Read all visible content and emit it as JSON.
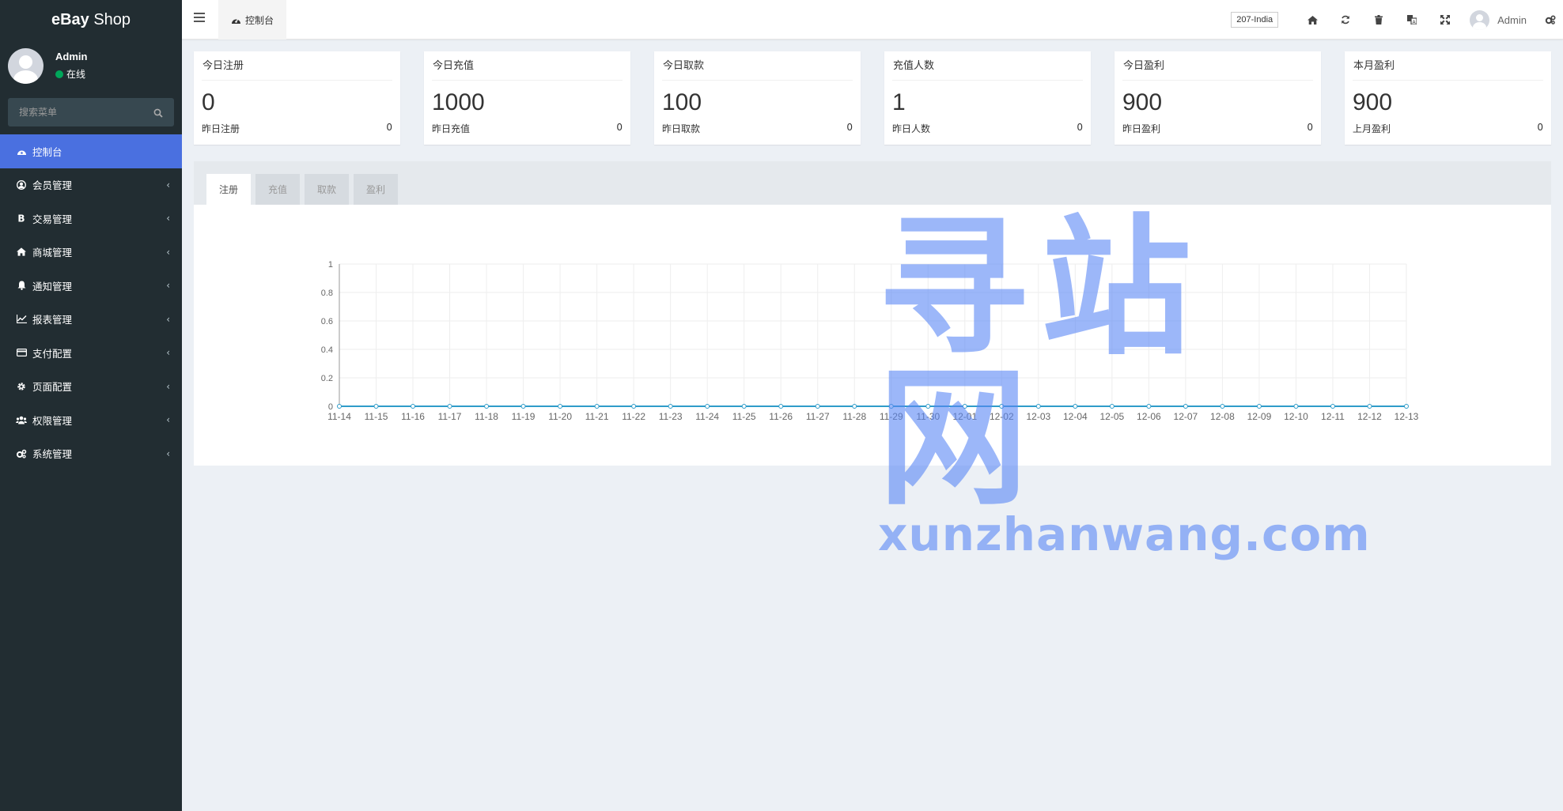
{
  "sidebar": {
    "logo_bold": "eBay",
    "logo_text": " Shop",
    "user": {
      "name": "Admin",
      "status": "在线"
    },
    "search_placeholder": "搜索菜单",
    "items": [
      {
        "label": "控制台",
        "icon": "dashboard-icon",
        "active": true
      },
      {
        "label": "会员管理",
        "icon": "user-circle-icon"
      },
      {
        "label": "交易管理",
        "icon": "bitcoin-icon"
      },
      {
        "label": "商城管理",
        "icon": "home-icon"
      },
      {
        "label": "通知管理",
        "icon": "bell-icon"
      },
      {
        "label": "报表管理",
        "icon": "line-chart-icon"
      },
      {
        "label": "支付配置",
        "icon": "credit-card-icon"
      },
      {
        "label": "页面配置",
        "icon": "gear-icon"
      },
      {
        "label": "权限管理",
        "icon": "users-icon"
      },
      {
        "label": "系统管理",
        "icon": "gears-icon"
      }
    ]
  },
  "header": {
    "tab_label": "控制台",
    "lang_badge": "207-India",
    "admin_name": "Admin",
    "icons": [
      "home-icon",
      "refresh-icon",
      "trash-icon",
      "language-icon",
      "fullscreen-icon"
    ]
  },
  "stats": [
    {
      "title": "今日注册",
      "value": "0",
      "footer_label": "昨日注册",
      "footer_value": "0"
    },
    {
      "title": "今日充值",
      "value": "1000",
      "footer_label": "昨日充值",
      "footer_value": "0"
    },
    {
      "title": "今日取款",
      "value": "100",
      "footer_label": "昨日取款",
      "footer_value": "0"
    },
    {
      "title": "充值人数",
      "value": "1",
      "footer_label": "昨日人数",
      "footer_value": "0"
    },
    {
      "title": "今日盈利",
      "value": "900",
      "footer_label": "昨日盈利",
      "footer_value": "0"
    },
    {
      "title": "本月盈利",
      "value": "900",
      "footer_label": "上月盈利",
      "footer_value": "0"
    }
  ],
  "chart_tabs": [
    {
      "label": "注册",
      "active": true
    },
    {
      "label": "充值"
    },
    {
      "label": "取款"
    },
    {
      "label": "盈利"
    }
  ],
  "chart_data": {
    "type": "line",
    "categories": [
      "11-14",
      "11-15",
      "11-16",
      "11-17",
      "11-18",
      "11-19",
      "11-20",
      "11-21",
      "11-22",
      "11-23",
      "11-24",
      "11-25",
      "11-26",
      "11-27",
      "11-28",
      "11-29",
      "11-30",
      "12-01",
      "12-02",
      "12-03",
      "12-04",
      "12-05",
      "12-06",
      "12-07",
      "12-08",
      "12-09",
      "12-10",
      "12-11",
      "12-12",
      "12-13"
    ],
    "values": [
      0,
      0,
      0,
      0,
      0,
      0,
      0,
      0,
      0,
      0,
      0,
      0,
      0,
      0,
      0,
      0,
      0,
      0,
      0,
      0,
      0,
      0,
      0,
      0,
      0,
      0,
      0,
      0,
      0,
      0
    ],
    "ylim": [
      0,
      1
    ],
    "yticks": [
      "0",
      "0.2",
      "0.4",
      "0.6",
      "0.8",
      "1"
    ],
    "grid": true,
    "color": "#2f9cc9"
  },
  "watermark": {
    "cn": "寻站网",
    "en": "xunzhanwang.com"
  }
}
